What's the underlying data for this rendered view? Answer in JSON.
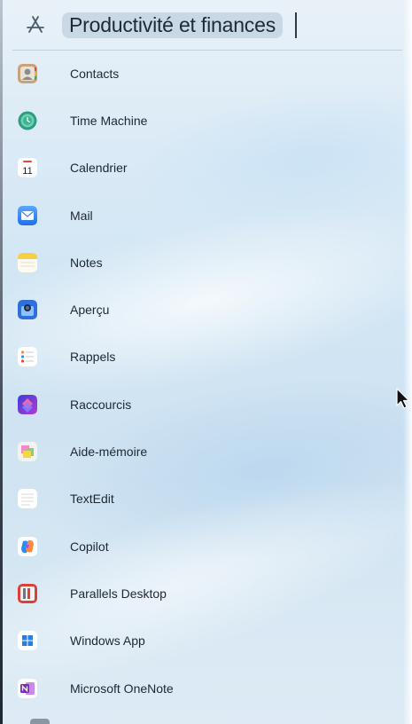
{
  "header": {
    "icon": "app-store-icon",
    "title": "Productivité et finances"
  },
  "apps": [
    {
      "label": "Contacts",
      "icon": "contacts-icon"
    },
    {
      "label": "Time Machine",
      "icon": "time-machine-icon"
    },
    {
      "label": "Calendrier",
      "icon": "calendar-icon",
      "icon_text": "11"
    },
    {
      "label": "Mail",
      "icon": "mail-icon"
    },
    {
      "label": "Notes",
      "icon": "notes-icon"
    },
    {
      "label": "Aperçu",
      "icon": "preview-icon"
    },
    {
      "label": "Rappels",
      "icon": "reminders-icon"
    },
    {
      "label": "Raccourcis",
      "icon": "shortcuts-icon"
    },
    {
      "label": "Aide-mémoire",
      "icon": "stickies-icon"
    },
    {
      "label": "TextEdit",
      "icon": "textedit-icon"
    },
    {
      "label": "Copilot",
      "icon": "copilot-icon"
    },
    {
      "label": "Parallels Desktop",
      "icon": "parallels-icon"
    },
    {
      "label": "Windows App",
      "icon": "windows-app-icon"
    },
    {
      "label": "Microsoft OneNote",
      "icon": "onenote-icon"
    }
  ],
  "colors": {
    "text": "#1c2733",
    "title_highlight": "#b0c4d6",
    "mail_blue": "#2f7ff5",
    "shortcuts_purple": "#6b3ad6",
    "onenote_purple": "#7b2fb5"
  }
}
